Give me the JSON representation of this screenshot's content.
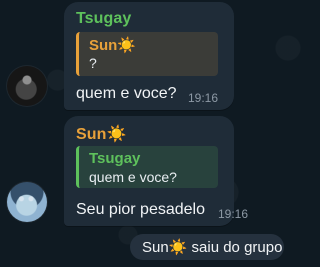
{
  "messages": [
    {
      "sender": "Tsugay",
      "quote": {
        "name": "Sun☀️",
        "text": "?"
      },
      "text": "quem e voce?",
      "time": "19:16"
    },
    {
      "sender": "Sun☀️",
      "quote": {
        "name": "Tsugay",
        "text": "quem e voce?"
      },
      "text": "Seu pior pesadelo",
      "time": "19:16"
    }
  ],
  "system_notice": "Sun☀️ saiu do grupo",
  "colors": {
    "background": "#0f1a22",
    "bubble": "#1f2c38",
    "tsugay_name": "#5ec15c",
    "sun_name": "#e8a13a",
    "text": "#f1f4f6",
    "time": "#8d99a5"
  },
  "icons": {
    "avatar_1": "dark-hooded-avatar",
    "avatar_2": "anime-avatar"
  }
}
